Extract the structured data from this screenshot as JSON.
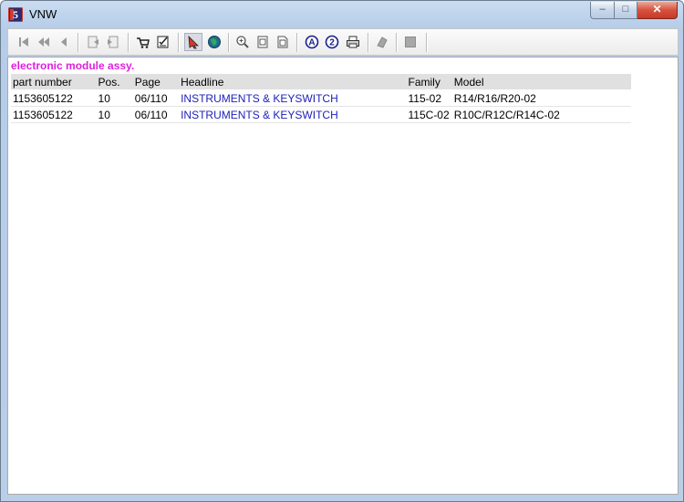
{
  "window": {
    "title": "VNW",
    "icon_label": "5",
    "controls": {
      "minimize": "–",
      "maximize": "□",
      "close": "✕"
    }
  },
  "toolbar": {
    "icons": [
      "first-icon",
      "previous-page-icon",
      "previous-icon",
      "back-doc-icon",
      "forward-doc-icon",
      "cart-icon",
      "checklist-icon",
      "pointer-icon",
      "globe-icon",
      "zoom-icon",
      "page-icon",
      "page-fold-icon",
      "search-a-icon",
      "search-2-icon",
      "print-icon",
      "eraser-icon",
      "stop-icon"
    ]
  },
  "content": {
    "group_title": "electronic module assy.",
    "columns": [
      "part number",
      "Pos.",
      "Page",
      "Headline",
      "Family",
      "Model"
    ],
    "rows": [
      [
        "1153605122",
        "10",
        "06/110",
        "INSTRUMENTS & KEYSWITCH",
        "115-02",
        "R14/R16/R20-02"
      ],
      [
        "1153605122",
        "10",
        "06/110",
        "INSTRUMENTS & KEYSWITCH",
        "115C-02",
        "R10C/R12C/R14C-02"
      ]
    ]
  },
  "colors": {
    "group_title": "#e020e0",
    "headline_link": "#1e22b9",
    "header_bg": "#e0e0e0"
  }
}
